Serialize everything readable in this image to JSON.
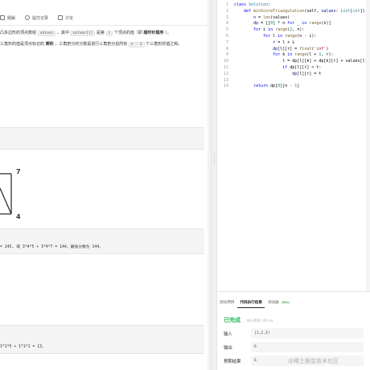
{
  "left_tabs": [
    {
      "label": "题解",
      "icon": "doc-icon"
    },
    {
      "label": "提交记录",
      "icon": "history-icon"
    },
    {
      "label": "讨论",
      "icon": "chat-icon"
    }
  ],
  "description": {
    "line1_a": "凸多边形的顶点数组",
    "line1_code1": "values",
    "line1_b": "，其中",
    "line1_code2": "values[i]",
    "line1_c": "是第",
    "line1_code3": "i",
    "line1_d": "个顶点的值（即",
    "line1_bold": "顺时针顺序",
    "line1_e": "）。",
    "line2_a": "三角形的值是顶点标记的",
    "line2_bold": "乘积",
    "line2_b": "，三角剖分的分数是进行三角剖分后所有",
    "line2_code": "n - 2",
    "line2_c": "个三角形的值之和。"
  },
  "diagram_labels": {
    "top_right": "7",
    "bottom_right": "4"
  },
  "example1_explanation": "= 245, 或 3*4*5 + 3*4*7 = 144。最低分数为 144。",
  "example2_explanation": "1*1*5 + 1*1*1 = 13。",
  "code_lines": [
    {
      "n": "1",
      "tokens": [
        [
          "kw",
          "class "
        ],
        [
          "ty",
          "Solution"
        ],
        [
          "op",
          ":"
        ]
      ]
    },
    {
      "n": "2",
      "tokens": [
        [
          "op",
          "    "
        ],
        [
          "kw",
          "def "
        ],
        [
          "fn",
          "minScoreTriangulation"
        ],
        [
          "op",
          "(self, "
        ],
        [
          "var",
          "values"
        ],
        [
          "op",
          ": "
        ],
        [
          "ty",
          "List"
        ],
        [
          "op",
          "["
        ],
        [
          "ty",
          "int"
        ],
        [
          "op",
          "]) -> "
        ]
      ]
    },
    {
      "n": "3",
      "tokens": [
        [
          "op",
          "        "
        ],
        [
          "var",
          "n"
        ],
        [
          "op",
          " = "
        ],
        [
          "fn",
          "len"
        ],
        [
          "op",
          "(values)"
        ]
      ]
    },
    {
      "n": "4",
      "tokens": [
        [
          "op",
          "        "
        ],
        [
          "var",
          "dp"
        ],
        [
          "op",
          " = [["
        ],
        [
          "nm",
          "0"
        ],
        [
          "op",
          "] * n "
        ],
        [
          "kw",
          "for"
        ],
        [
          "op",
          " _ "
        ],
        [
          "kw",
          "in"
        ],
        [
          "op",
          " "
        ],
        [
          "fn",
          "range"
        ],
        [
          "op",
          "(n)]"
        ]
      ]
    },
    {
      "n": "5",
      "tokens": [
        [
          "op",
          "        "
        ],
        [
          "kw",
          "for"
        ],
        [
          "op",
          " i "
        ],
        [
          "kw",
          "in"
        ],
        [
          "op",
          " "
        ],
        [
          "fn",
          "range"
        ],
        [
          "op",
          "("
        ],
        [
          "nm",
          "2"
        ],
        [
          "op",
          ", n):"
        ]
      ]
    },
    {
      "n": "6",
      "tokens": [
        [
          "op",
          "            "
        ],
        [
          "kw",
          "for"
        ],
        [
          "op",
          " l "
        ],
        [
          "kw",
          "in"
        ],
        [
          "op",
          " "
        ],
        [
          "fn",
          "range"
        ],
        [
          "op",
          "(n - i):"
        ]
      ]
    },
    {
      "n": "7",
      "tokens": [
        [
          "op",
          "                "
        ],
        [
          "var",
          "r"
        ],
        [
          "op",
          " = l + i"
        ]
      ]
    },
    {
      "n": "8",
      "tokens": [
        [
          "op",
          "                "
        ],
        [
          "var",
          "dp"
        ],
        [
          "op",
          "[l][r] = "
        ],
        [
          "fn",
          "float"
        ],
        [
          "op",
          "("
        ],
        [
          "st",
          "'inf'"
        ],
        [
          "op",
          ")"
        ]
      ]
    },
    {
      "n": "9",
      "tokens": [
        [
          "op",
          "                "
        ],
        [
          "kw",
          "for"
        ],
        [
          "op",
          " k "
        ],
        [
          "kw",
          "in"
        ],
        [
          "op",
          " "
        ],
        [
          "fn",
          "range"
        ],
        [
          "op",
          "(l + "
        ],
        [
          "nm",
          "1"
        ],
        [
          "op",
          ", r):"
        ]
      ]
    },
    {
      "n": "10",
      "tokens": [
        [
          "op",
          "                    "
        ],
        [
          "var",
          "t"
        ],
        [
          "op",
          " = dp[l][k] + dp[k][r] + values[l] * "
        ]
      ]
    },
    {
      "n": "11",
      "tokens": [
        [
          "op",
          "                    "
        ],
        [
          "kw",
          "if"
        ],
        [
          "op",
          " dp[l][r] > t:"
        ]
      ]
    },
    {
      "n": "12",
      "tokens": [
        [
          "op",
          "                        "
        ],
        [
          "var",
          "dp"
        ],
        [
          "op",
          "[l][r] = t"
        ]
      ]
    },
    {
      "n": "13",
      "tokens": [
        [
          "op",
          ""
        ]
      ]
    },
    {
      "n": "14",
      "tokens": [
        [
          "op",
          "        "
        ],
        [
          "kw",
          "return"
        ],
        [
          "op",
          " dp["
        ],
        [
          "nm",
          "0"
        ],
        [
          "op",
          "][n - "
        ],
        [
          "nm",
          "1"
        ],
        [
          "op",
          "]"
        ]
      ]
    }
  ],
  "console": {
    "tabs": [
      {
        "label": "测试用例",
        "active": false
      },
      {
        "label": "代码执行结果",
        "active": true
      },
      {
        "label": "调试器",
        "active": false,
        "badge": "Beta"
      }
    ],
    "status": "已完成",
    "time": "执行用时: 40 ms",
    "rows": [
      {
        "label": "输入",
        "value": "[1,2,3]"
      },
      {
        "label": "输出",
        "value": "6"
      },
      {
        "label": "预期结果",
        "value": "6"
      }
    ]
  },
  "watermark": "@稀土掘金技术社区",
  "colors": {
    "success": "#2db55d",
    "keyword": "#0000ff",
    "function": "#795e26"
  }
}
